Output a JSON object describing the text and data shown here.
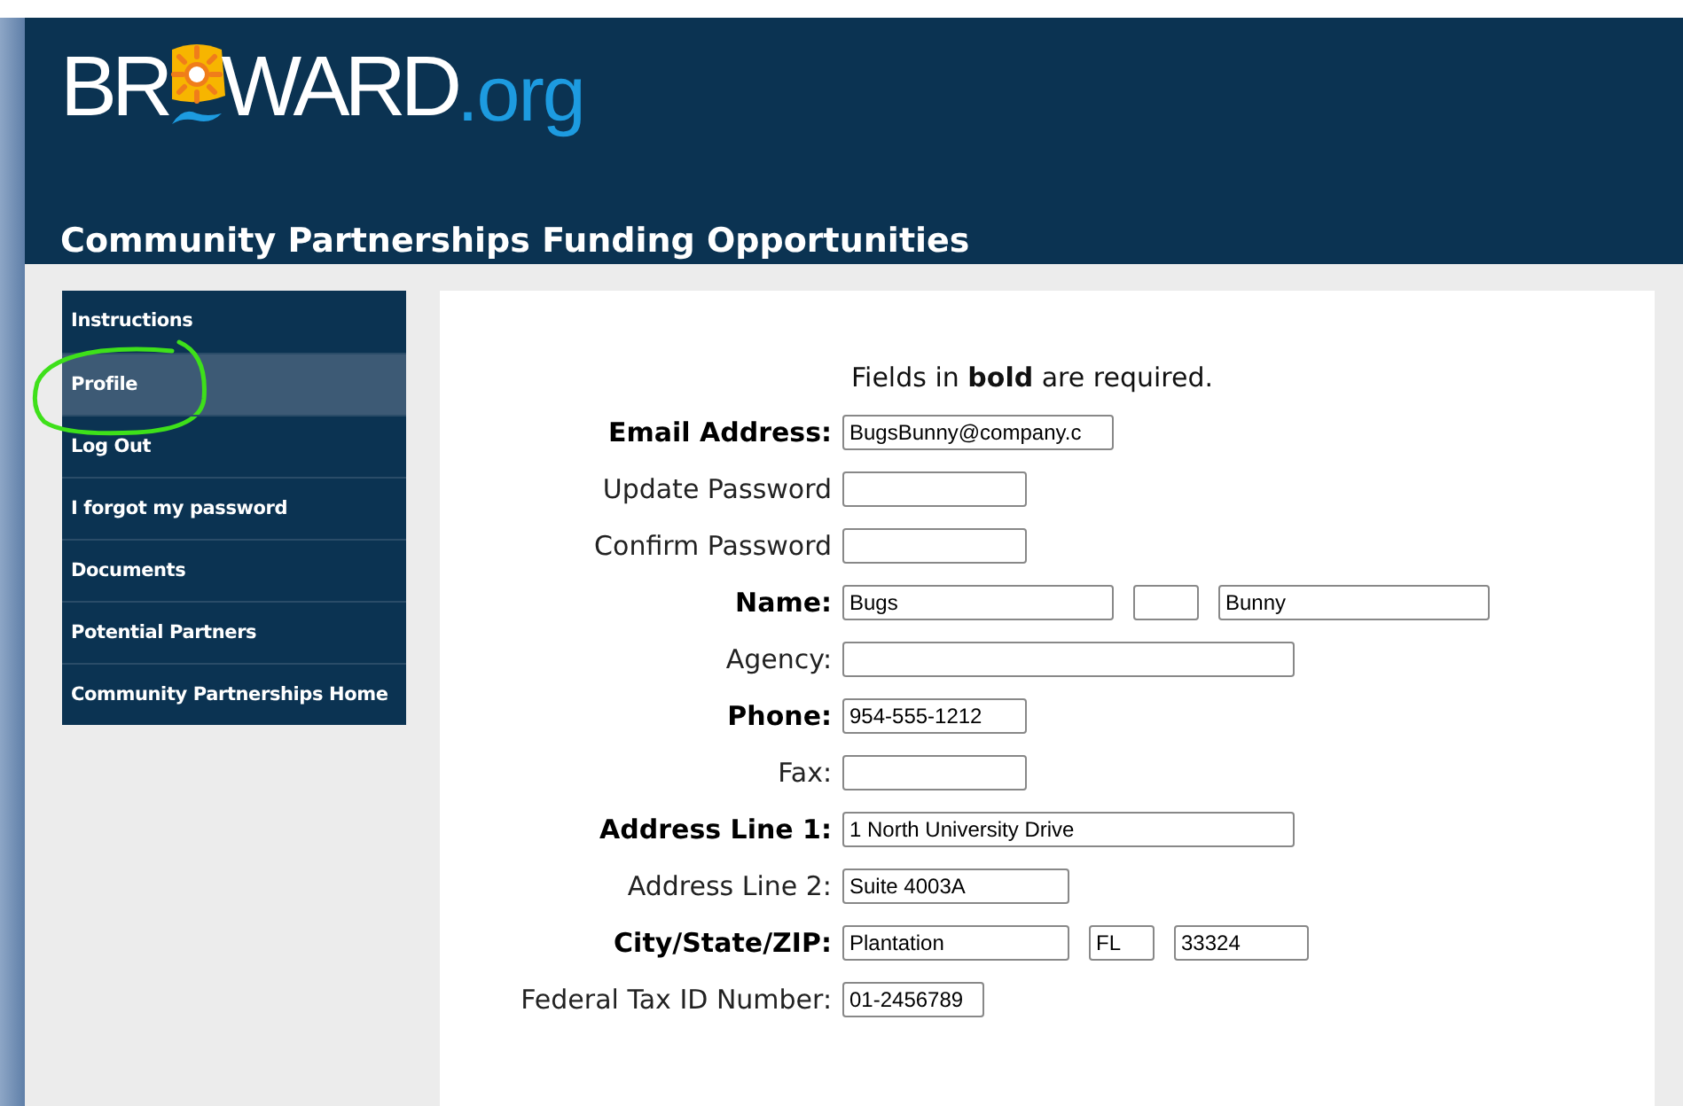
{
  "logo": {
    "before": "BR",
    "after": "WARD",
    "suffix": ".org"
  },
  "title": "Community Partnerships Funding Opportunities",
  "sidebar": {
    "items": [
      {
        "label": "Instructions",
        "selected": false,
        "circled": false
      },
      {
        "label": "Profile",
        "selected": true,
        "circled": true
      },
      {
        "label": "Log Out",
        "selected": false,
        "circled": false
      },
      {
        "label": "I forgot my password",
        "selected": false,
        "circled": false
      },
      {
        "label": "Documents",
        "selected": false,
        "circled": false
      },
      {
        "label": "Potential Partners",
        "selected": false,
        "circled": false
      },
      {
        "label": "Community Partnerships Home",
        "selected": false,
        "circled": false
      }
    ]
  },
  "form": {
    "note": "Fields in **bold** are required.",
    "rows": [
      {
        "label": "Email Address:",
        "required": true,
        "fields": [
          {
            "kind": "long",
            "value": "BugsBunny@company.c"
          }
        ]
      },
      {
        "label": "Update Password",
        "required": false,
        "fields": [
          {
            "kind": "short"
          }
        ]
      },
      {
        "label": "Confirm Password",
        "required": false,
        "fields": [
          {
            "kind": "short"
          }
        ]
      },
      {
        "label": "Name:",
        "required": true,
        "fields": [
          {
            "kind": "long",
            "value": "Bugs"
          },
          {
            "kind": "tiny"
          },
          {
            "kind": "long",
            "value": "Bunny"
          }
        ]
      },
      {
        "label": "Agency:",
        "required": false,
        "fields": [
          {
            "kind": "wide"
          }
        ]
      },
      {
        "label": "Phone:",
        "required": true,
        "fields": [
          {
            "kind": "short",
            "value": "954-555-1212"
          }
        ]
      },
      {
        "label": "Fax:",
        "required": false,
        "fields": [
          {
            "kind": "short"
          }
        ]
      },
      {
        "label": "Address Line 1:",
        "required": true,
        "fields": [
          {
            "kind": "wide",
            "value": "1 North University Drive"
          }
        ]
      },
      {
        "label": "Address Line 2:",
        "required": false,
        "fields": [
          {
            "kind": "medium",
            "value": "Suite 4003A"
          }
        ]
      },
      {
        "label": "City/State/ZIP:",
        "required": true,
        "fields": [
          {
            "kind": "medium",
            "value": "Plantation"
          },
          {
            "kind": "tiny",
            "value": "FL"
          },
          {
            "kind": "zip",
            "value": "33324"
          }
        ]
      },
      {
        "label": "Federal Tax ID Number:",
        "required": false,
        "fields": [
          {
            "kind": "taxid",
            "value": "01-2456789"
          }
        ]
      }
    ]
  }
}
